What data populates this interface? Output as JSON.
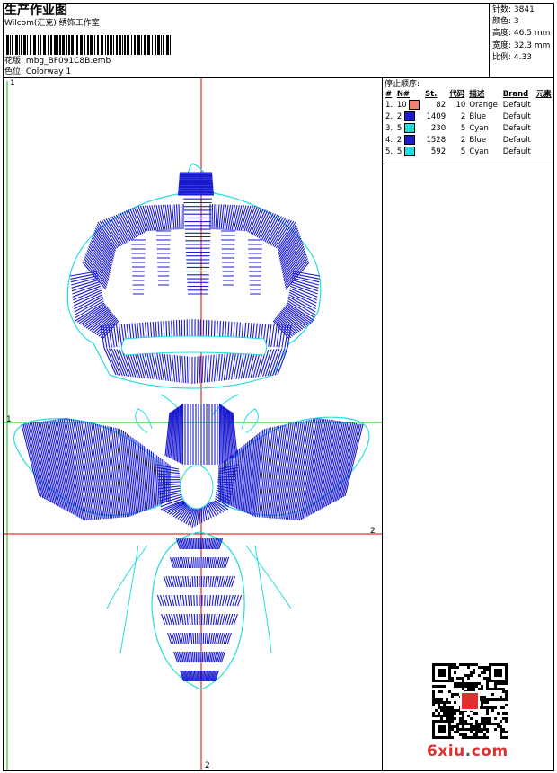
{
  "header": {
    "title": "生产作业图",
    "company": "Wilcom(汇克) 绣饰工作室",
    "design_label": "花版:",
    "design_file": "mbg_BF091C8B.emb",
    "colorway_label": "色位:",
    "colorway": "Colorway 1"
  },
  "stats": [
    {
      "label": "针数:",
      "value": "3841"
    },
    {
      "label": "颜色:",
      "value": "3"
    },
    {
      "label": "高度:",
      "value": "46.5 mm"
    },
    {
      "label": "宽度:",
      "value": "32.3 mm"
    },
    {
      "label": "比例:",
      "value": "4.33"
    }
  ],
  "stop_sequence": {
    "title": "停止顺序:",
    "columns": [
      "#",
      "N#",
      "St.",
      "代码",
      "描述",
      "Brand",
      "元素"
    ],
    "rows": [
      {
        "idx": "1.",
        "n": "10",
        "color": "#f08070",
        "st": "82",
        "code": "10",
        "desc": "Orange",
        "brand": "Default"
      },
      {
        "idx": "2.",
        "n": "2",
        "color": "#1a1ad0",
        "st": "1409",
        "code": "2",
        "desc": "Blue",
        "brand": "Default"
      },
      {
        "idx": "3.",
        "n": "5",
        "color": "#22dde0",
        "st": "230",
        "code": "5",
        "desc": "Cyan",
        "brand": "Default"
      },
      {
        "idx": "4.",
        "n": "2",
        "color": "#1a1ad0",
        "st": "1528",
        "code": "2",
        "desc": "Blue",
        "brand": "Default"
      },
      {
        "idx": "5.",
        "n": "5",
        "color": "#22dde0",
        "st": "592",
        "code": "5",
        "desc": "Cyan",
        "brand": "Default"
      }
    ]
  },
  "axis_labels": {
    "top_left": "1",
    "mid_left": "1",
    "right": "2",
    "bottom": "2"
  },
  "watermark": {
    "site_main": "6xiu",
    "site_dot": ".",
    "site_tld": "com"
  },
  "colors": {
    "blue": "#1a1ad0",
    "cyan": "#22dde0",
    "red": "#e00000",
    "green": "#00c000"
  }
}
